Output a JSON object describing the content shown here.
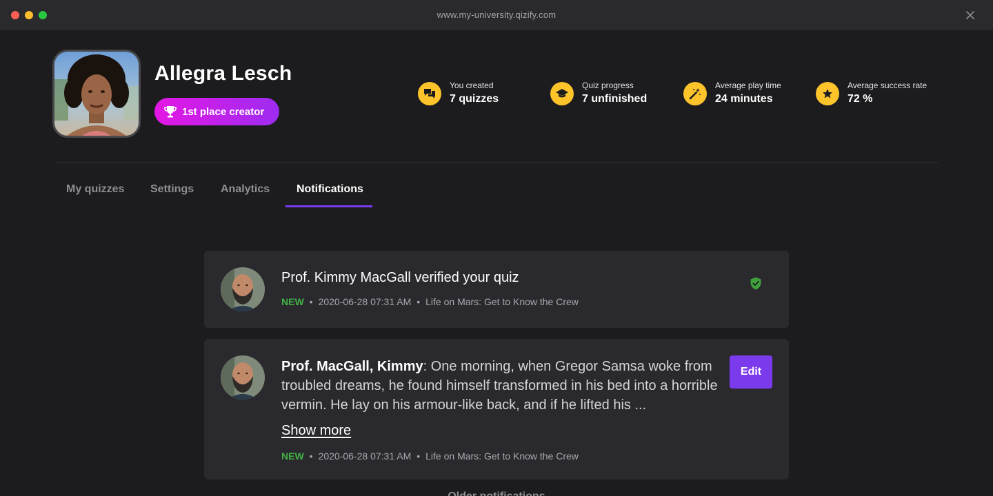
{
  "window": {
    "url": "www.my-university.qizify.com",
    "close_icon": "close-icon"
  },
  "profile": {
    "name": "Allegra Lesch",
    "badge_label": "1st place creator",
    "badge_icon": "trophy-icon",
    "badge_gradient": [
      "#e417e4",
      "#9e2cf0"
    ]
  },
  "stats": [
    {
      "icon": "chat-bubbles-icon",
      "label": "You created",
      "value": "7 quizzes"
    },
    {
      "icon": "graduation-cap-icon",
      "label": "Quiz progress",
      "value": "7 unfinished"
    },
    {
      "icon": "magic-wand-icon",
      "label": "Average play time",
      "value": "24 minutes"
    },
    {
      "icon": "star-icon",
      "label": "Average success rate",
      "value": "72 %"
    }
  ],
  "tabs": [
    {
      "label": "My quizzes",
      "active": false
    },
    {
      "label": "Settings",
      "active": false
    },
    {
      "label": "Analytics",
      "active": false
    },
    {
      "label": "Notifications",
      "active": true
    }
  ],
  "notifications": [
    {
      "title": "Prof. Kimmy MacGall verified your quiz",
      "status": "NEW",
      "timestamp": "2020-06-28 07:31 AM",
      "quiz": "Life on Mars: Get to Know the Crew",
      "icon": "verified-shield-icon"
    },
    {
      "author": "Prof. MacGall, Kimmy",
      "message": ": One morning, when Gregor Samsa woke from troubled dreams, he found himself transformed in his bed into a horrible vermin. He lay on his armour-like back, and if he lifted his ...",
      "show_more": "Show more",
      "edit_label": "Edit",
      "status": "NEW",
      "timestamp": "2020-06-28 07:31 AM",
      "quiz": "Life on Mars: Get to Know the Crew"
    }
  ],
  "older_label": "Older notifications",
  "colors": {
    "accent": "#7c3aed",
    "stat_icon_bg": "#fcc42a",
    "new_status": "#43b244",
    "background": "#1c1c1f",
    "card": "#2a2a2e"
  }
}
